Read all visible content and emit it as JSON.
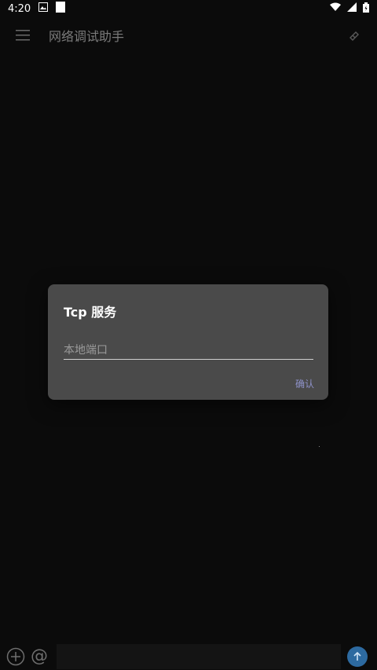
{
  "status_bar": {
    "time": "4:20"
  },
  "app_bar": {
    "title": "网络调试助手"
  },
  "dialog": {
    "title": "Tcp 服务",
    "input_placeholder": "本地端口",
    "input_value": "",
    "confirm_label": "确认"
  },
  "bottom_bar": {
    "at_label": "@",
    "message_value": ""
  },
  "colors": {
    "background": "#0b0b0b",
    "dialog": "#4a4a4a",
    "accent": "#8e92c9",
    "send": "#2d6aa0"
  }
}
